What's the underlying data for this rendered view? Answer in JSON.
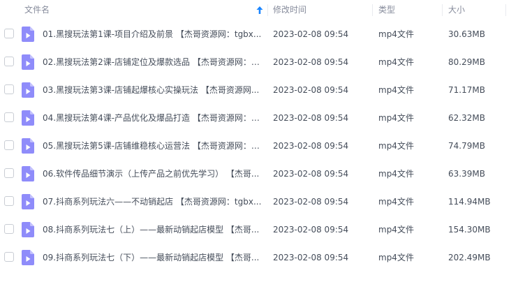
{
  "header": {
    "name": "文件名",
    "modified": "修改时间",
    "type": "类型",
    "size": "大小",
    "sort_icon": "arrow-up-icon"
  },
  "colors": {
    "accent": "#1a85ff",
    "file_icon": "#8f8cfa",
    "header_text": "#878c9c",
    "row_text": "#454d5a"
  },
  "rows": [
    {
      "name": "01.黑搜玩法第1课-项目介绍及前景 【杰哥资源网：tgbx...",
      "time": "2023-02-08 09:54",
      "type": "mp4文件",
      "size": "30.63MB"
    },
    {
      "name": "02.黑搜玩法第2课-店铺定位及爆款选品 【杰哥资源网：t...",
      "time": "2023-02-08 09:54",
      "type": "mp4文件",
      "size": "80.29MB"
    },
    {
      "name": "03.黑搜玩法第3课-店铺起爆核心实操玩法 【杰哥资源网...",
      "time": "2023-02-08 09:54",
      "type": "mp4文件",
      "size": "71.17MB"
    },
    {
      "name": "04.黑搜玩法第4课-产品优化及爆品打造 【杰哥资源网：t...",
      "time": "2023-02-08 09:54",
      "type": "mp4文件",
      "size": "62.32MB"
    },
    {
      "name": "05.黑搜玩法第5课-店铺维稳核心运营法 【杰哥资源网：t...",
      "time": "2023-02-08 09:54",
      "type": "mp4文件",
      "size": "74.79MB"
    },
    {
      "name": "06.软件传品细节演示（上传产品之前优先学习） 【杰哥...",
      "time": "2023-02-08 09:54",
      "type": "mp4文件",
      "size": "63.39MB"
    },
    {
      "name": "07.抖商系列玩法六——不动销起店 【杰哥资源网：tgbx...",
      "time": "2023-02-08 09:54",
      "type": "mp4文件",
      "size": "114.94MB"
    },
    {
      "name": "08.抖商系列玩法七（上）——最新动销起店模型 【杰哥...",
      "time": "2023-02-08 09:54",
      "type": "mp4文件",
      "size": "154.30MB"
    },
    {
      "name": "09.抖商系列玩法七（下）——最新动销起店模型 【杰哥...",
      "time": "2023-02-08 09:54",
      "type": "mp4文件",
      "size": "202.49MB"
    }
  ]
}
